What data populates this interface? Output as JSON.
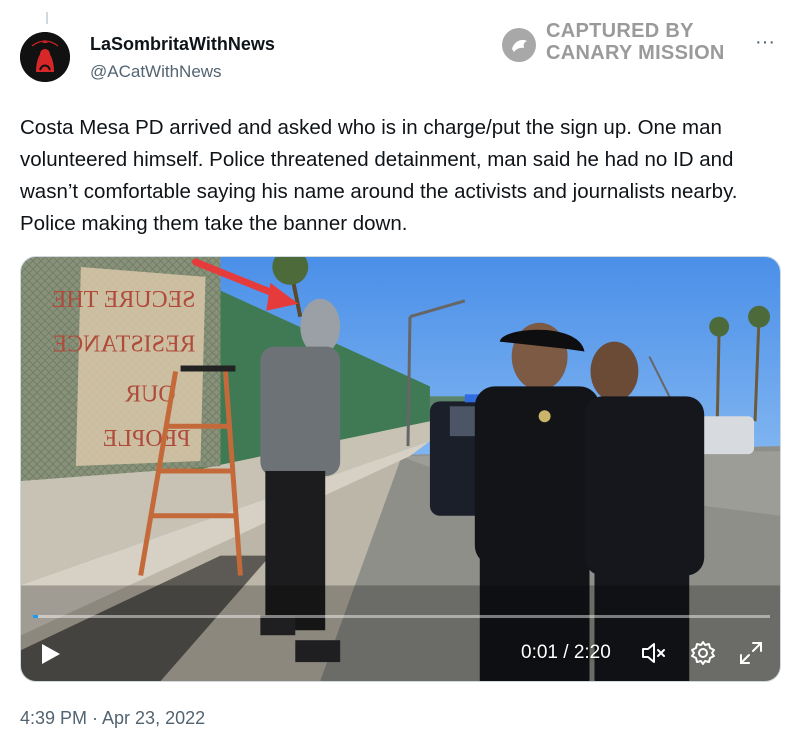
{
  "author": {
    "display_name": "LaSombritaWithNews",
    "handle": "@ACatWithNews"
  },
  "watermark": {
    "line1": "CAPTURED BY",
    "line2": "CANARY MISSION"
  },
  "more_label": "···",
  "tweet": {
    "text": "Costa Mesa PD arrived and asked who is in charge/put the sign up. One man volunteered himself. Police threatened detainment, man said he had no ID and wasn’t comfortable saying his name around the activists and journalists nearby. Police making them take the banner down."
  },
  "video": {
    "current_time": "0:01",
    "duration": "2:20",
    "time_display": "0:01 / 2:20",
    "progress": 0.007,
    "icons": [
      "play-icon",
      "mute-icon",
      "settings-icon",
      "fullscreen-icon"
    ]
  },
  "timestamp": "4:39 PM · Apr 23, 2022",
  "colors": {
    "accent": "#1d9bf0",
    "text": "#0f1419",
    "muted": "#536471"
  }
}
